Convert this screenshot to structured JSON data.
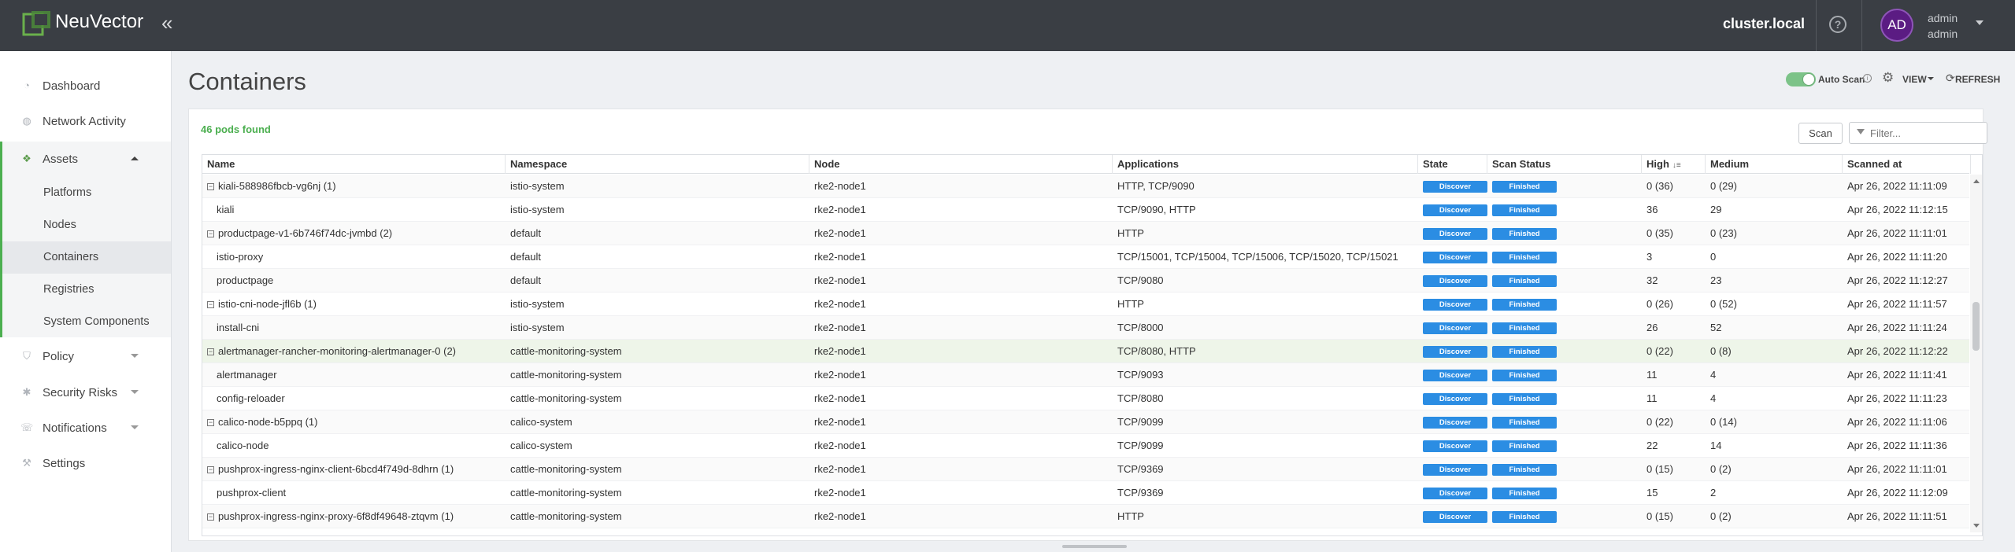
{
  "app": {
    "brand": "NeuVector",
    "cluster": "cluster.local",
    "help_glyph": "?",
    "collapse_glyph": "«",
    "user": {
      "initials": "AD",
      "name": "admin",
      "role": "admin"
    }
  },
  "sidebar": {
    "items": [
      {
        "label": "Dashboard",
        "icon": "dashboard-icon"
      },
      {
        "label": "Network Activity",
        "icon": "globe-icon"
      },
      {
        "label": "Assets",
        "icon": "cubes-icon",
        "expanded": true
      },
      {
        "label": "Policy",
        "icon": "shield-icon"
      },
      {
        "label": "Security Risks",
        "icon": "bug-icon"
      },
      {
        "label": "Notifications",
        "icon": "bell-icon"
      },
      {
        "label": "Settings",
        "icon": "wrench-icon"
      }
    ],
    "assets_children": [
      "Platforms",
      "Nodes",
      "Containers",
      "Registries",
      "System Components"
    ],
    "active_child": "Containers"
  },
  "page": {
    "title": "Containers",
    "auto_scan_label": "Auto Scan",
    "auto_scan_enabled": true,
    "view_label": "VIEW",
    "refresh_label": "REFRESH",
    "pods_found": "46 pods found",
    "scan_button": "Scan",
    "filter_placeholder": "Filter..."
  },
  "table": {
    "columns": [
      "Name",
      "Namespace",
      "Node",
      "Applications",
      "State",
      "Scan Status",
      "High",
      "Medium",
      "Scanned at"
    ],
    "sorted_column": "High",
    "rows": [
      {
        "name": "kiali-588986fbcb-vg6nj (1)",
        "group": true,
        "namespace": "istio-system",
        "node": "rke2-node1",
        "apps": "HTTP, TCP/9090",
        "state": "Discover",
        "scan": "Finished",
        "high": "0 (36)",
        "medium": "0 (29)",
        "scanned": "Apr 26, 2022 11:11:09"
      },
      {
        "name": "kiali",
        "group": false,
        "namespace": "istio-system",
        "node": "rke2-node1",
        "apps": "TCP/9090, HTTP",
        "state": "Discover",
        "scan": "Finished",
        "high": "36",
        "medium": "29",
        "scanned": "Apr 26, 2022 11:12:15"
      },
      {
        "name": "productpage-v1-6b746f74dc-jvmbd (2)",
        "group": true,
        "namespace": "default",
        "node": "rke2-node1",
        "apps": "HTTP",
        "state": "Discover",
        "scan": "Finished",
        "high": "0 (35)",
        "medium": "0 (23)",
        "scanned": "Apr 26, 2022 11:11:01"
      },
      {
        "name": "istio-proxy",
        "group": false,
        "namespace": "default",
        "node": "rke2-node1",
        "apps": "TCP/15001, TCP/15004, TCP/15006, TCP/15020, TCP/15021",
        "state": "Discover",
        "scan": "Finished",
        "high": "3",
        "medium": "0",
        "scanned": "Apr 26, 2022 11:11:20"
      },
      {
        "name": "productpage",
        "group": false,
        "namespace": "default",
        "node": "rke2-node1",
        "apps": "TCP/9080",
        "state": "Discover",
        "scan": "Finished",
        "high": "32",
        "medium": "23",
        "scanned": "Apr 26, 2022 11:12:27"
      },
      {
        "name": "istio-cni-node-jfl6b (1)",
        "group": true,
        "namespace": "istio-system",
        "node": "rke2-node1",
        "apps": "HTTP",
        "state": "Discover",
        "scan": "Finished",
        "high": "0 (26)",
        "medium": "0 (52)",
        "scanned": "Apr 26, 2022 11:11:57"
      },
      {
        "name": "install-cni",
        "group": false,
        "namespace": "istio-system",
        "node": "rke2-node1",
        "apps": "TCP/8000",
        "state": "Discover",
        "scan": "Finished",
        "high": "26",
        "medium": "52",
        "scanned": "Apr 26, 2022 11:11:24"
      },
      {
        "name": "alertmanager-rancher-monitoring-alertmanager-0 (2)",
        "group": true,
        "selected": true,
        "namespace": "cattle-monitoring-system",
        "node": "rke2-node1",
        "apps": "TCP/8080, HTTP",
        "state": "Discover",
        "scan": "Finished",
        "high": "0 (22)",
        "medium": "0 (8)",
        "scanned": "Apr 26, 2022 11:12:22"
      },
      {
        "name": "alertmanager",
        "group": false,
        "namespace": "cattle-monitoring-system",
        "node": "rke2-node1",
        "apps": "TCP/9093",
        "state": "Discover",
        "scan": "Finished",
        "high": "11",
        "medium": "4",
        "scanned": "Apr 26, 2022 11:11:41"
      },
      {
        "name": "config-reloader",
        "group": false,
        "namespace": "cattle-monitoring-system",
        "node": "rke2-node1",
        "apps": "TCP/8080",
        "state": "Discover",
        "scan": "Finished",
        "high": "11",
        "medium": "4",
        "scanned": "Apr 26, 2022 11:11:23"
      },
      {
        "name": "calico-node-b5ppq (1)",
        "group": true,
        "namespace": "calico-system",
        "node": "rke2-node1",
        "apps": "TCP/9099",
        "state": "Discover",
        "scan": "Finished",
        "high": "0 (22)",
        "medium": "0 (14)",
        "scanned": "Apr 26, 2022 11:11:06"
      },
      {
        "name": "calico-node",
        "group": false,
        "namespace": "calico-system",
        "node": "rke2-node1",
        "apps": "TCP/9099",
        "state": "Discover",
        "scan": "Finished",
        "high": "22",
        "medium": "14",
        "scanned": "Apr 26, 2022 11:11:36"
      },
      {
        "name": "pushprox-ingress-nginx-client-6bcd4f749d-8dhrn (1)",
        "group": true,
        "namespace": "cattle-monitoring-system",
        "node": "rke2-node1",
        "apps": "TCP/9369",
        "state": "Discover",
        "scan": "Finished",
        "high": "0 (15)",
        "medium": "0 (2)",
        "scanned": "Apr 26, 2022 11:11:01"
      },
      {
        "name": "pushprox-client",
        "group": false,
        "namespace": "cattle-monitoring-system",
        "node": "rke2-node1",
        "apps": "TCP/9369",
        "state": "Discover",
        "scan": "Finished",
        "high": "15",
        "medium": "2",
        "scanned": "Apr 26, 2022 11:12:09"
      },
      {
        "name": "pushprox-ingress-nginx-proxy-6f8df49648-ztqvm (1)",
        "group": true,
        "namespace": "cattle-monitoring-system",
        "node": "rke2-node1",
        "apps": "HTTP",
        "state": "Discover",
        "scan": "Finished",
        "high": "0 (15)",
        "medium": "0 (2)",
        "scanned": "Apr 26, 2022 11:11:51"
      }
    ]
  },
  "colors": {
    "topbar": "#3a3e44",
    "accent_green": "#4caf50",
    "badge_blue": "#2b8de3",
    "avatar_purple": "#5b1c83"
  }
}
